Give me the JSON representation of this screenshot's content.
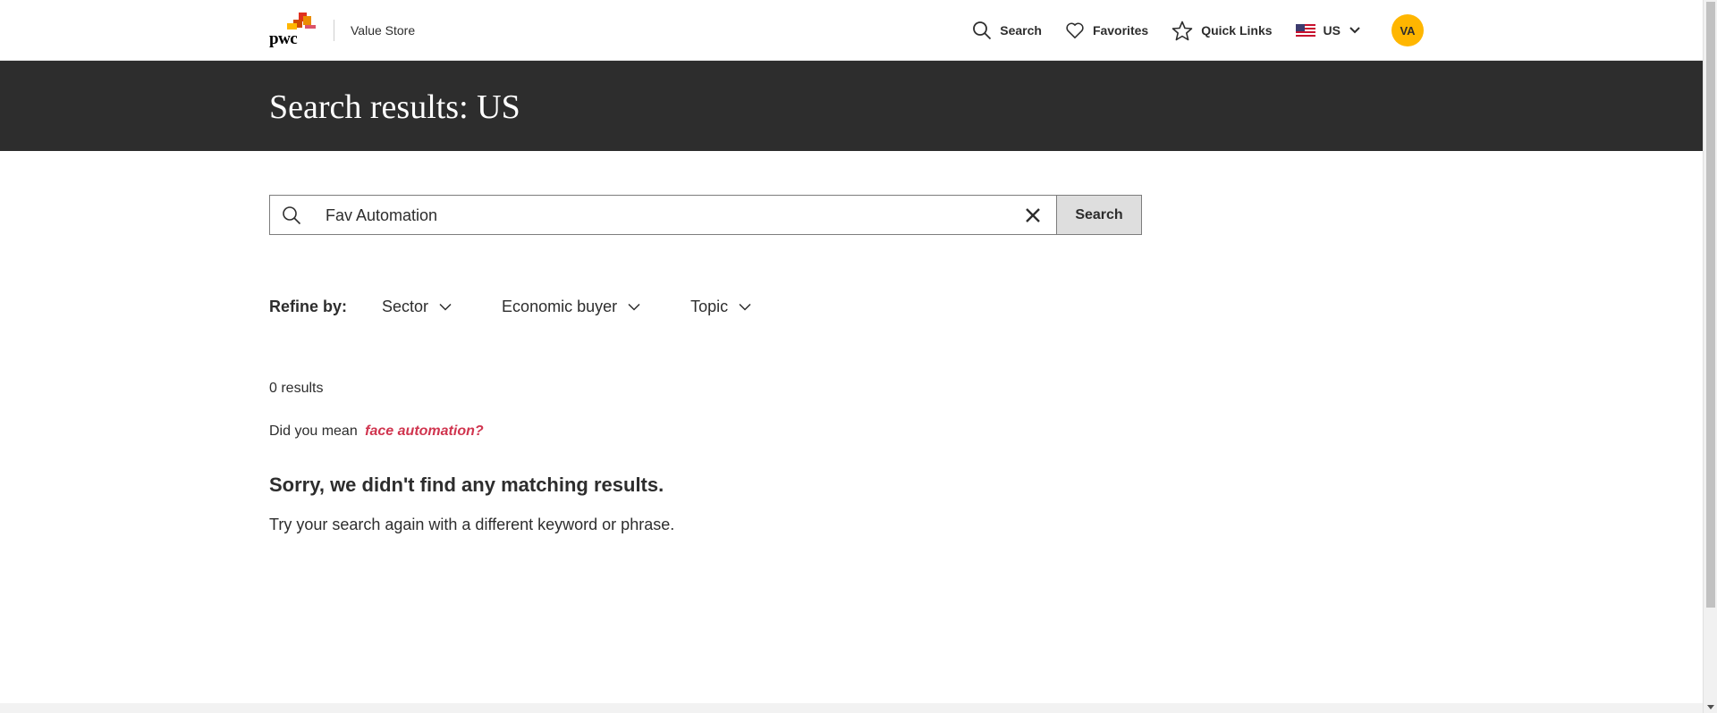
{
  "header": {
    "brand_name": "Value Store",
    "logo_text": "pwc",
    "nav": {
      "search_label": "Search",
      "favorites_label": "Favorites",
      "quicklinks_label": "Quick Links",
      "region_label": "US"
    },
    "avatar_initials": "VA"
  },
  "hero": {
    "title": "Search results: US"
  },
  "search": {
    "value": "Fav Automation",
    "button_label": "Search"
  },
  "refine": {
    "label": "Refine by:",
    "filters": [
      "Sector",
      "Economic buyer",
      "Topic"
    ]
  },
  "results": {
    "count_text": "0 results",
    "did_you_mean_prefix": "Did you mean",
    "suggestion": "face automation?",
    "no_results_heading": "Sorry, we didn't find any matching results.",
    "no_results_hint": "Try your search again with a different keyword or phrase."
  },
  "colors": {
    "hero_bg": "#2d2d2d",
    "accent_link": "#d0354f",
    "avatar_bg": "#ffb600"
  }
}
